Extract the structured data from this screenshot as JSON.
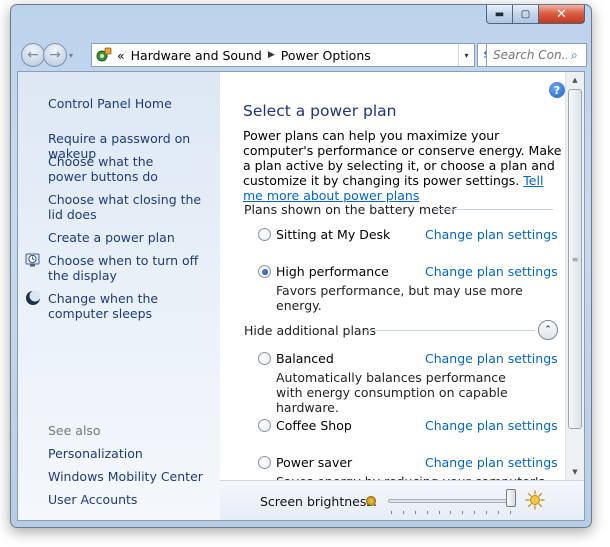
{
  "window": {
    "minimize_label": "▬",
    "maximize_label": "▢",
    "close_label": "✕"
  },
  "navigation": {
    "back_glyph": "←",
    "forward_glyph": "→",
    "dropdown_glyph": "▾"
  },
  "address": {
    "overflow": "«",
    "crumbs": [
      "Hardware and Sound",
      "Power Options"
    ],
    "separator": "▶",
    "dropdown_glyph": "▾"
  },
  "refresh_glyph": "⇆",
  "search": {
    "placeholder": "Search Con...",
    "icon_glyph": "⌕"
  },
  "sidebar": {
    "home": "Control Panel Home",
    "links": [
      "Require a password on wakeup",
      "Choose what the power buttons do",
      "Choose what closing the lid does",
      "Create a power plan",
      "Choose when to turn off the display",
      "Change when the computer sleeps"
    ],
    "see_also_title": "See also",
    "see_also": [
      "Personalization",
      "Windows Mobility Center",
      "User Accounts"
    ]
  },
  "main": {
    "help_glyph": "?",
    "title": "Select a power plan",
    "intro_text": "Power plans can help you maximize your computer's performance or conserve energy. Make a plan active by selecting it, or choose a plan and customize it by changing its power settings. ",
    "intro_link": "Tell me more about power plans",
    "battery_section": "Plans shown on the battery meter",
    "hidden_section": "Hide additional plans",
    "collapse_glyph": "⌃",
    "change_label": "Change plan settings",
    "plans": [
      {
        "name": "Sitting at My Desk",
        "desc": "",
        "selected": false
      },
      {
        "name": "High performance",
        "desc": "Favors performance, but may use more energy.",
        "selected": true
      },
      {
        "name": "Balanced",
        "desc": "Automatically balances performance with energy consumption on capable hardware.",
        "selected": false
      },
      {
        "name": "Coffee Shop",
        "desc": "",
        "selected": false
      },
      {
        "name": "Power saver",
        "desc": "Saves energy by reducing your computer's",
        "selected": false
      }
    ]
  },
  "scrollbar": {
    "up_glyph": "▲",
    "down_glyph": "▼",
    "grip_glyph": "≡"
  },
  "brightness": {
    "label": "Screen brightness:",
    "level_percent": 100
  }
}
